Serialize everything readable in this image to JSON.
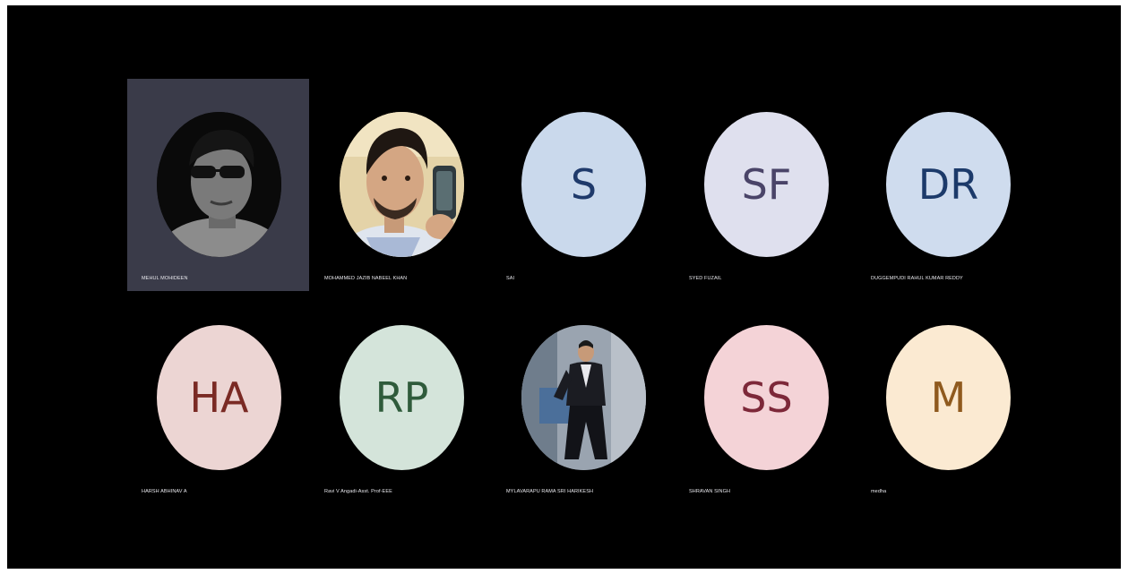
{
  "participants": [
    {
      "name": "MEHUL MOHIDEEN",
      "type": "photo",
      "photo_icon": "person-sunglasses-photo",
      "active": true
    },
    {
      "name": "MOHAMMED JAZIB NABEEL KHAN",
      "type": "photo",
      "photo_icon": "person-selfie-photo"
    },
    {
      "name": "SAI",
      "type": "initials",
      "initials": "S",
      "bg": "#cad9ec",
      "fg": "#1f3a6b"
    },
    {
      "name": "SYED FUZAIL",
      "type": "initials",
      "initials": "SF",
      "bg": "#dfe0ee",
      "fg": "#4a4468"
    },
    {
      "name": "DUGGEMPUDI RAHUL KUMAR REDDY",
      "type": "initials",
      "initials": "DR",
      "bg": "#cfdcee",
      "fg": "#1c3a6a"
    },
    {
      "name": "HARSH ABHINAV A",
      "type": "initials",
      "initials": "HA",
      "bg": "#ecd5d3",
      "fg": "#7a2a24"
    },
    {
      "name": "Ravi V Angadi-Asst. Prof-EEE",
      "type": "initials",
      "initials": "RP",
      "bg": "#d4e4da",
      "fg": "#2f5b3b"
    },
    {
      "name": "MYLAVARAPU RAMA SRI HARIKESH",
      "type": "photo",
      "photo_icon": "person-suit-photo"
    },
    {
      "name": "SHRAVAN SINGH",
      "type": "initials",
      "initials": "SS",
      "bg": "#f4d3d7",
      "fg": "#7d2839"
    },
    {
      "name": "medha",
      "type": "initials",
      "initials": "M",
      "bg": "#fbead2",
      "fg": "#8f5a1e"
    }
  ],
  "colors": {
    "background": "#000000",
    "active_tile": "#3a3b49",
    "name_text": "#e9e9ee"
  }
}
